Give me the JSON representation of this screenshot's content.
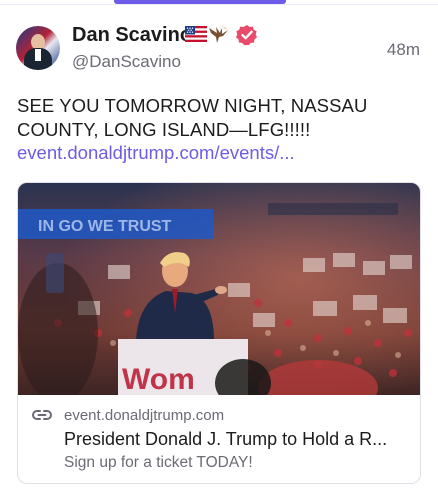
{
  "post": {
    "author": {
      "display_name": "Dan Scavino",
      "handle": "@DanScavino",
      "badges": [
        "us-flag-icon",
        "eagle-icon",
        "verified-icon"
      ]
    },
    "timestamp": "48m",
    "text": "SEE YOU TOMORROW NIGHT, NASSAU COUNTY, LONG ISLAND—LFG!!!!!",
    "link_text": "event.donaldjtrump.com/events/..."
  },
  "card": {
    "domain": "event.donaldjtrump.com",
    "title": "President Donald J. Trump to Hold a R...",
    "description": "Sign up for a ticket TODAY!",
    "image_sign_text": "Wom"
  },
  "colors": {
    "accent": "#6c5ce7",
    "verified": "#e94b6a",
    "text": "#1c1c1e",
    "muted": "#6b6b75"
  }
}
